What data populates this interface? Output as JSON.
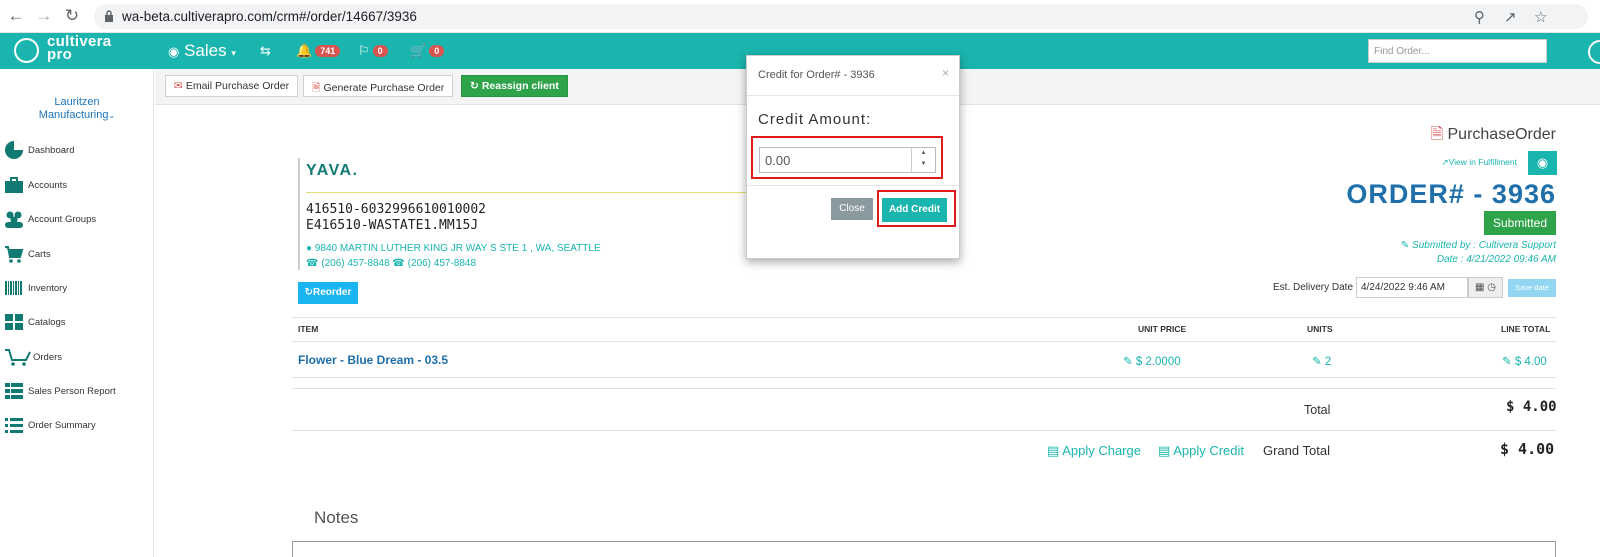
{
  "browser": {
    "url": "wa-beta.cultiverapro.com/crm#/order/14667/3936"
  },
  "header": {
    "logo_line1": "cultivera",
    "logo_line2": "pro",
    "sales_label": "Sales",
    "notifications_count": "741",
    "flags_count": "0",
    "cart_count": "0",
    "find_order_placeholder": "Find Order..."
  },
  "sidebar": {
    "client_name_line1": "Lauritzen",
    "client_name_line2": "Manufacturing",
    "items": [
      {
        "label": "Dashboard",
        "icon": "pie-chart-icon"
      },
      {
        "label": "Accounts",
        "icon": "briefcase-icon"
      },
      {
        "label": "Account Groups",
        "icon": "users-icon"
      },
      {
        "label": "Carts",
        "icon": "cart-icon"
      },
      {
        "label": "Inventory",
        "icon": "barcode-icon"
      },
      {
        "label": "Catalogs",
        "icon": "grid-icon"
      },
      {
        "label": "Orders",
        "icon": "shopping-cart-icon"
      },
      {
        "label": "Sales Person Report",
        "icon": "table-icon"
      },
      {
        "label": "Order Summary",
        "icon": "list-icon"
      }
    ]
  },
  "toolbar": {
    "email_po": "Email Purchase Order",
    "generate_po": "Generate Purchase Order",
    "reassign": "Reassign client"
  },
  "vendor": {
    "name": "YAVA.",
    "license1": "416510-6032996610010002",
    "license2": "E416510-WASTATE1.MM15J",
    "address": "9840 MARTIN LUTHER KING JR WAY S STE 1 , WA, SEATTLE",
    "phone1": "(206) 457-8848",
    "phone2": "(206) 457-8848",
    "reorder": "Reorder"
  },
  "order": {
    "doc_title": "PurchaseOrder",
    "view_fulfillment": "View in Fulfillment",
    "number": "ORDER# - 3936",
    "status": "Submitted",
    "submitted_by": "Submitted by : Cultivera Support",
    "date": "Date : 4/21/2022 09:46 AM",
    "est_delivery_label": "Est. Delivery Date",
    "est_delivery_value": "4/24/2022 9:46 AM",
    "save_date": "Save date"
  },
  "table": {
    "headers": {
      "item": "ITEM",
      "unit_price": "UNIT PRICE",
      "units": "UNITS",
      "line_total": "LINE TOTAL"
    },
    "rows": [
      {
        "item": "Flower - Blue Dream - 03.5",
        "unit_price": "$ 2.0000",
        "units": "2",
        "line_total": "$ 4.00"
      }
    ],
    "total_label": "Total",
    "total_value": "$ 4.00",
    "apply_charge": "Apply Charge",
    "apply_credit": "Apply Credit",
    "grand_total_label": "Grand Total",
    "grand_total_value": "$ 4.00"
  },
  "notes": {
    "label": "Notes"
  },
  "modal": {
    "title": "Credit for Order# - 3936",
    "close_x": "×",
    "credit_label": "Credit Amount:",
    "credit_value": "0.00",
    "close_button": "Close",
    "add_credit_button": "Add Credit"
  },
  "colors": {
    "brand_teal": "#1ab5ae",
    "order_blue": "#1f6fab",
    "submitted_green": "#2fa34a",
    "highlight_red": "#e01b1b"
  }
}
